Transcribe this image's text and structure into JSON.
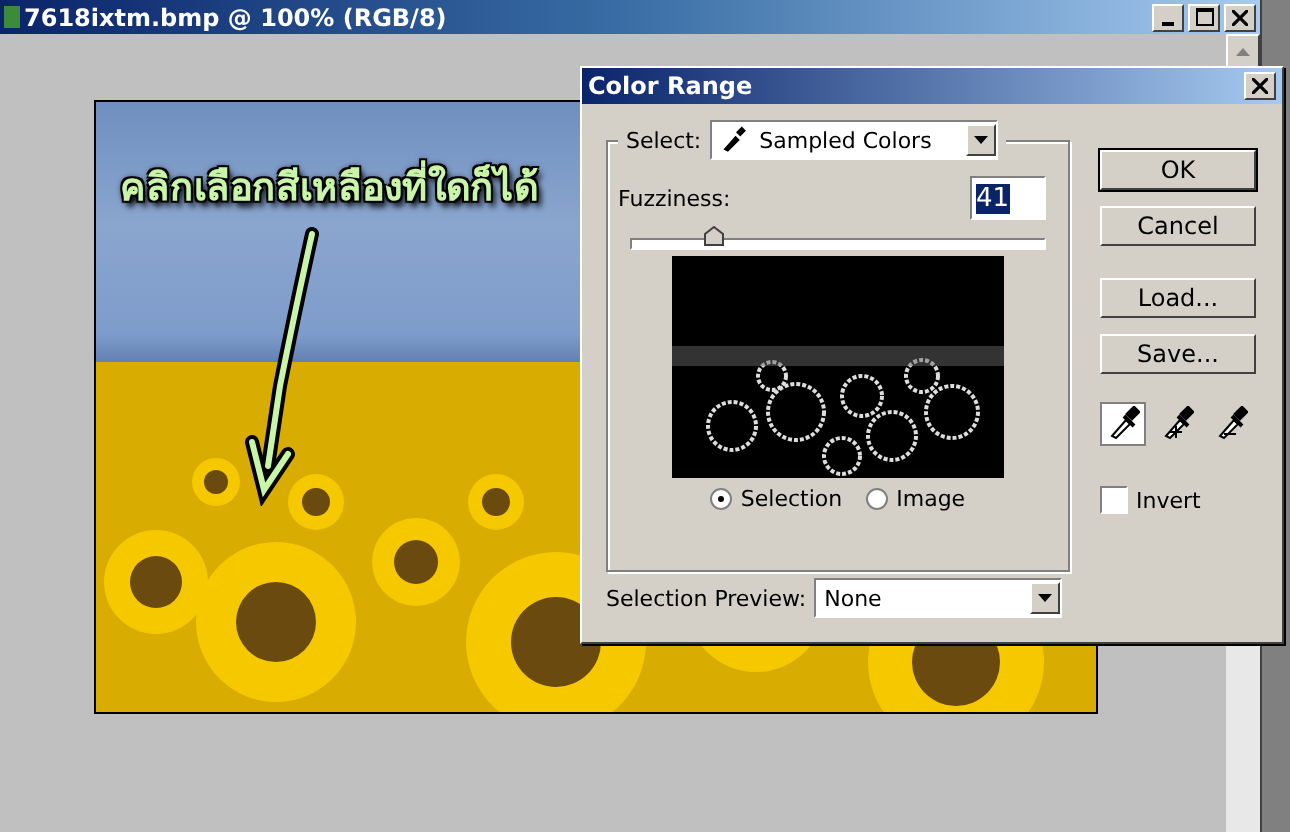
{
  "document": {
    "title": "7618ixtm.bmp @ 100% (RGB/8)",
    "annotation": "คลิกเลือกสีเหลืองที่ใดก็ได้"
  },
  "dialog": {
    "title": "Color Range",
    "select": {
      "label": "Select:",
      "value": "Sampled Colors"
    },
    "fuzziness": {
      "label": "Fuzziness:",
      "value": "41",
      "level": 0.2
    },
    "preview_modes": [
      {
        "label": "Selection",
        "selected": true
      },
      {
        "label": "Image",
        "selected": false
      }
    ],
    "selection_preview": {
      "label": "Selection Preview:",
      "value": "None"
    },
    "buttons": [
      "OK",
      "Cancel",
      "Load...",
      "Save..."
    ],
    "eyedroppers": [
      {
        "kind": "plain",
        "selected": true
      },
      {
        "kind": "add",
        "selected": false
      },
      {
        "kind": "subtract",
        "selected": false
      }
    ],
    "invert": {
      "label": "Invert",
      "checked": false
    }
  }
}
